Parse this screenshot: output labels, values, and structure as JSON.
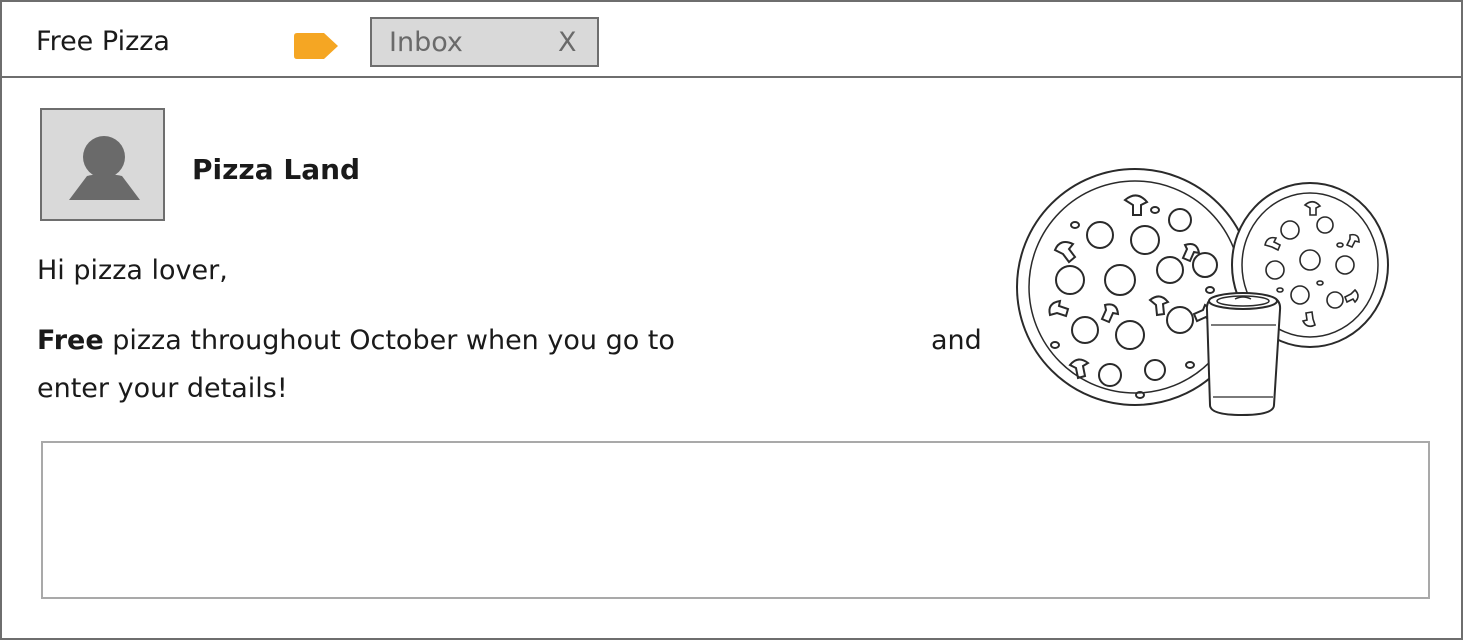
{
  "email": {
    "subject": "Free Pizza",
    "label_color": "#f5a623",
    "folder_chip": {
      "label": "Inbox",
      "close_label": "X"
    },
    "sender": {
      "name": "Pizza Land"
    },
    "greeting": "Hi pizza lover,",
    "body": {
      "emphasis": "Free",
      "line1_rest": " pizza throughout October when you go to",
      "line1_end": "and",
      "line2": "enter your details!"
    },
    "illustration_icon": "pizza-and-drink-illustration",
    "answer_box": {
      "value": ""
    }
  }
}
